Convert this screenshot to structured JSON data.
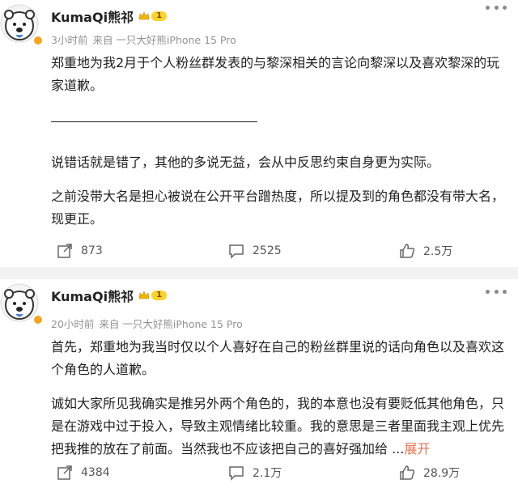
{
  "posts": [
    {
      "user": {
        "name": "KumaQi熊祁",
        "level": "1"
      },
      "meta": {
        "time": "3小时前",
        "source": "来自 一只大好熊iPhone 15 Pro"
      },
      "paragraphs": [
        "郑重地为我2月于个人粉丝群发表的与黎深相关的言论向黎深以及喜欢黎深的玩家道歉。",
        "说错话就是错了，其他的多说无益，会从中反思约束自身更为实际。",
        "之前没带大名是担心被说在公开平台蹭热度，所以提及到的角色都没有带大名，现更正。"
      ],
      "actions": {
        "repost": "873",
        "comment": "2525",
        "like": "2.5万"
      }
    },
    {
      "user": {
        "name": "KumaQi熊祁",
        "level": "1"
      },
      "meta": {
        "time": "20小时前",
        "source": "来自 一只大好熊iPhone 15 Pro"
      },
      "paragraphs": [
        "首先，郑重地为我当时仅以个人喜好在自己的粉丝群里说的话向角色以及喜欢这个角色的人道歉。",
        "诚如大家所见我确实是推另外两个角色的，我的本意也没有要贬低其他角色，只是在游戏中过于投入，导致主观情绪比较重。我的意思是三者里面我主观上优先把我推的放在了前面。当然我也不应该把自己的喜好强加给 ..."
      ],
      "expand_label": "展开",
      "actions": {
        "repost": "4384",
        "comment": "2.1万",
        "like": "28.9万"
      }
    }
  ],
  "icons": [
    "bear-avatar-icon",
    "verified-badge-icon",
    "crown-icon",
    "more-icon",
    "repost-icon",
    "comment-icon",
    "like-icon"
  ],
  "colors": {
    "expand": "#eb7350",
    "meta": "#939393",
    "level_badge": "#ffd22a",
    "divider": "#f2f2f2"
  }
}
